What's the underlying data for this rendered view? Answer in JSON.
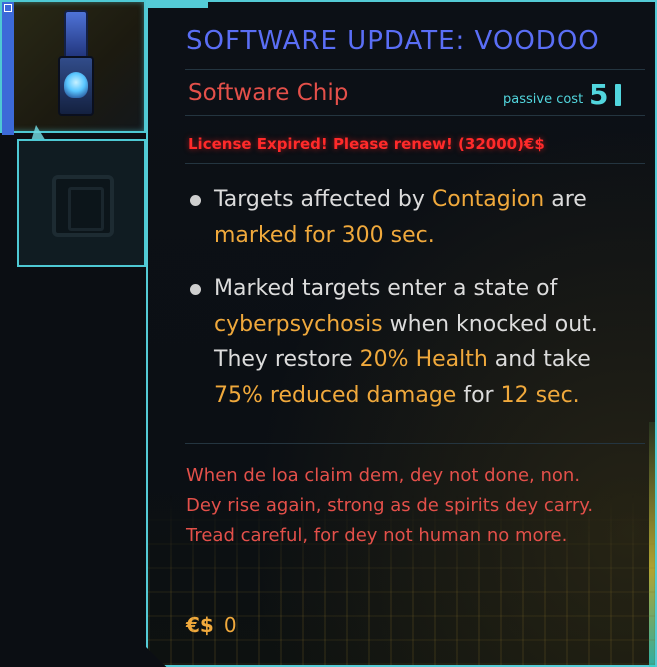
{
  "title": "SOFTWARE UPDATE: VOODOO",
  "item_type": "Software Chip",
  "passive_cost": {
    "label": "passive cost",
    "value": "5"
  },
  "license_notice": "License Expired! Please renew! (32000)€$",
  "bullets": [
    {
      "parts": [
        {
          "text": "Targets affected by ",
          "hl": false
        },
        {
          "text": "Contagion",
          "hl": true
        },
        {
          "text": " are ",
          "hl": false
        },
        {
          "text": "marked for 300 sec.",
          "hl": true
        }
      ]
    },
    {
      "parts": [
        {
          "text": "Marked targets enter a state of ",
          "hl": false
        },
        {
          "text": "cyberpsychosis",
          "hl": true
        },
        {
          "text": " when knocked out. They restore ",
          "hl": false
        },
        {
          "text": "20% Health",
          "hl": true
        },
        {
          "text": " and take ",
          "hl": false
        },
        {
          "text": "75% reduced damage",
          "hl": true
        },
        {
          "text": " for ",
          "hl": false
        },
        {
          "text": "12 sec.",
          "hl": true
        }
      ]
    }
  ],
  "lore": "When de loa claim dem, dey not done, non. Dey rise again, strong as de spirits dey carry. Tread careful, for dey not human no more.",
  "price": {
    "currency": "€$",
    "amount": "0"
  },
  "colors": {
    "title": "#5a6ef5",
    "red_text": "#e4504a",
    "highlight": "#f0a93c",
    "cyan": "#52d6de",
    "alert": "#ff2a2a"
  },
  "icons": {
    "chip": "voodoo-chip-icon",
    "empty_slot": "empty-slot-icon",
    "bullet": "bullet-dot-icon"
  }
}
